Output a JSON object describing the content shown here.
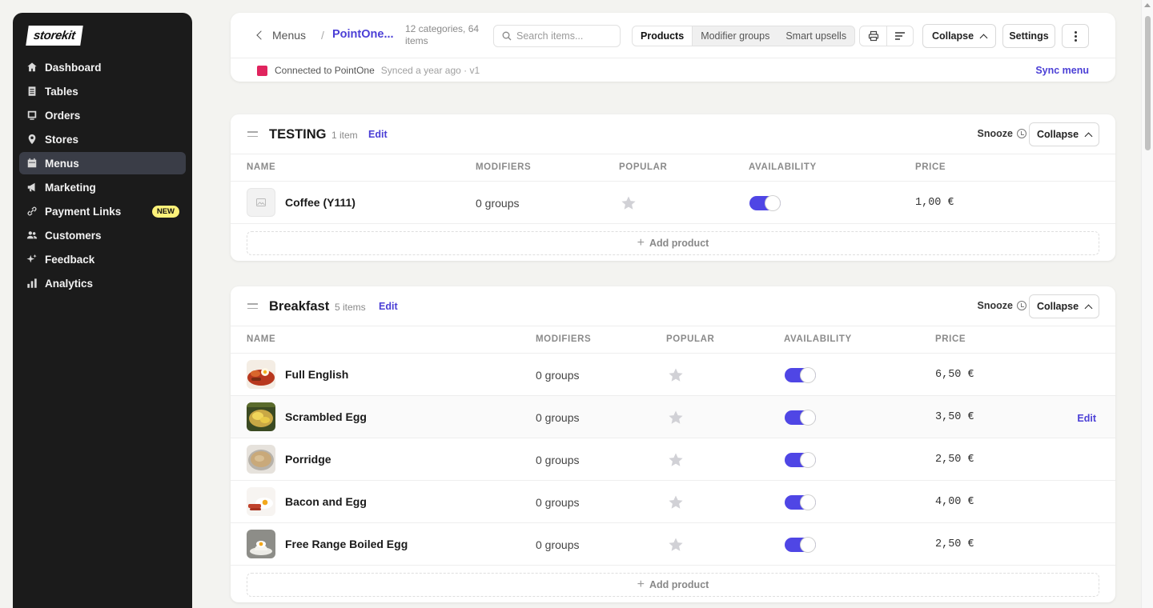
{
  "sidebar": {
    "logo": "storekit",
    "items": [
      {
        "label": "Dashboard",
        "icon": "home-icon"
      },
      {
        "label": "Tables",
        "icon": "tables-icon"
      },
      {
        "label": "Orders",
        "icon": "orders-icon"
      },
      {
        "label": "Stores",
        "icon": "location-pin-icon"
      },
      {
        "label": "Menus",
        "icon": "calendar-icon",
        "active": true
      },
      {
        "label": "Marketing",
        "icon": "megaphone-icon"
      },
      {
        "label": "Payment Links",
        "icon": "link-icon",
        "badge": "NEW"
      },
      {
        "label": "Customers",
        "icon": "users-icon"
      },
      {
        "label": "Feedback",
        "icon": "sparkle-icon"
      },
      {
        "label": "Analytics",
        "icon": "bar-chart-icon"
      }
    ]
  },
  "header": {
    "back_label": "Menus",
    "separator": "/",
    "menu_name": "PointOne...",
    "stats": "12 categories, 64 items",
    "search_placeholder": "Search items...",
    "tabs": [
      "Products",
      "Modifier groups",
      "Smart upsells"
    ],
    "active_tab": "Products",
    "collapse_label": "Collapse",
    "settings_label": "Settings",
    "connected_text": "Connected to PointOne",
    "synced_text": "Synced a year ago · v1",
    "sync_label": "Sync menu",
    "accent_color": "#4b3fd6"
  },
  "columns": {
    "name": "NAME",
    "modifiers": "MODIFIERS",
    "popular": "POPULAR",
    "availability": "AVAILABILITY",
    "price": "PRICE"
  },
  "categories": [
    {
      "title": "TESTING",
      "count": "1 item",
      "edit": "Edit",
      "snooze": "Snooze",
      "collapse": "Collapse",
      "products": [
        {
          "name": "Coffee (Y111)",
          "modifiers": "0 groups",
          "price": "1,00 €",
          "available": true,
          "image": "placeholder-icon"
        }
      ],
      "add_label": "Add product"
    },
    {
      "title": "Breakfast",
      "count": "5 items",
      "edit": "Edit",
      "snooze": "Snooze",
      "collapse": "Collapse",
      "products": [
        {
          "name": "Full English",
          "modifiers": "0 groups",
          "price": "6,50 €",
          "available": true,
          "image": "full-english-photo"
        },
        {
          "name": "Scrambled Egg",
          "modifiers": "0 groups",
          "price": "3,50 €",
          "available": true,
          "image": "scrambled-egg-photo",
          "row_edit": "Edit"
        },
        {
          "name": "Porridge",
          "modifiers": "0 groups",
          "price": "2,50 €",
          "available": true,
          "image": "porridge-photo"
        },
        {
          "name": "Bacon and Egg",
          "modifiers": "0 groups",
          "price": "4,00 €",
          "available": true,
          "image": "bacon-egg-photo"
        },
        {
          "name": "Free Range Boiled Egg",
          "modifiers": "0 groups",
          "price": "2,50 €",
          "available": true,
          "image": "boiled-egg-photo"
        }
      ],
      "add_label": "Add product"
    }
  ]
}
